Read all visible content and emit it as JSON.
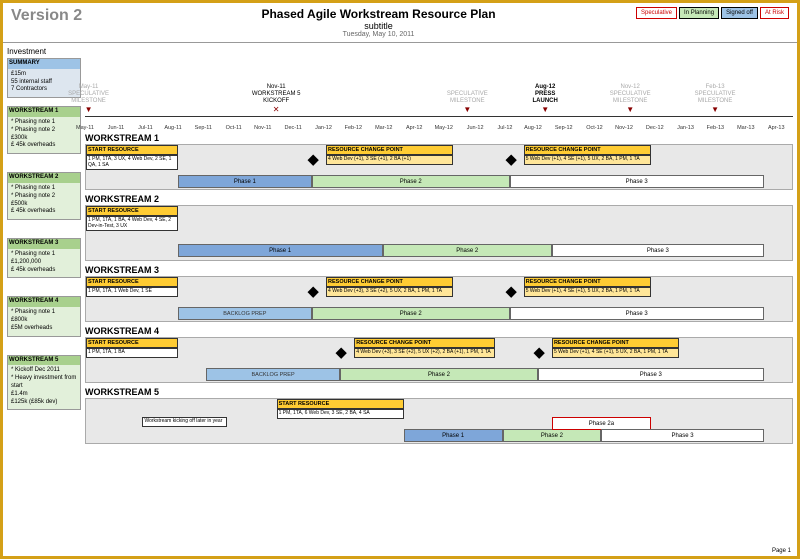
{
  "header": {
    "version": "Version 2",
    "title": "Phased Agile Workstream Resource Plan",
    "subtitle": "subtitle",
    "date": "Tuesday, May 10, 2011"
  },
  "legend": {
    "speculative": "Speculative",
    "planning": "In Planning",
    "signed": "Signed off",
    "risk": "At Risk"
  },
  "sidebar": {
    "investment": "Investment",
    "summary": {
      "title": "SUMMARY",
      "l1": "£15m",
      "l2": "55 internal staff",
      "l3": "7 Contractors"
    },
    "ws": [
      {
        "title": "WORKSTREAM 1",
        "l1": "* Phasing note 1",
        "l2": "* Phasing note 2",
        "l3": "£300k",
        "l4": "£ 45k overheads"
      },
      {
        "title": "WORKSTREAM 2",
        "l1": "* Phasing note 1",
        "l2": "* Phasing note 2",
        "l3": "£500k",
        "l4": "£ 45k overheads"
      },
      {
        "title": "WORKSTREAM 3",
        "l1": "* Phasing note 1",
        "l2": "",
        "l3": "£1,200,000",
        "l4": "£ 45k overheads"
      },
      {
        "title": "WORKSTREAM 4",
        "l1": "* Phasing note 1",
        "l2": "",
        "l3": "£800k",
        "l4": "£5M overheads"
      },
      {
        "title": "WORKSTREAM 5",
        "l1": "* Kickoff Dec 2011",
        "l2": "* Heavy investment from start",
        "l3": "£1.4m",
        "l4": "£125k (£85k dev)"
      }
    ]
  },
  "timeline": {
    "months": [
      "May-11",
      "Jun-11",
      "Jul-11",
      "Aug-11",
      "Sep-11",
      "Oct-11",
      "Nov-11",
      "Dec-11",
      "Jan-12",
      "Feb-12",
      "Mar-12",
      "Apr-12",
      "May-12",
      "Jun-12",
      "Jul-12",
      "Aug-12",
      "Sep-12",
      "Oct-12",
      "Nov-12",
      "Dec-12",
      "Jan-13",
      "Feb-13",
      "Mar-13",
      "Apr-13"
    ],
    "milestones": [
      {
        "pos": 0.5,
        "t1": "May-11",
        "t2": "SPECULATIVE",
        "t3": "MILESTONE",
        "gray": true,
        "mark": "▼"
      },
      {
        "pos": 27,
        "t1": "Nov-11",
        "t2": "WORKSTREAM 5",
        "t3": "KICKOFF",
        "gray": false,
        "mark": "✕"
      },
      {
        "pos": 54,
        "t1": "",
        "t2": "SPECULATIVE",
        "t3": "MILESTONE",
        "gray": true,
        "mark": "▼"
      },
      {
        "pos": 65,
        "t1": "Aug-12",
        "t2": "PRESS",
        "t3": "LAUNCH",
        "gray": false,
        "mark": "▼",
        "bold": true
      },
      {
        "pos": 77,
        "t1": "Nov-12",
        "t2": "SPECULATIVE",
        "t3": "MILESTONE",
        "gray": true,
        "mark": "▼"
      },
      {
        "pos": 89,
        "t1": "Feb-13",
        "t2": "SPECULATIVE",
        "t3": "MILESTONE",
        "gray": true,
        "mark": "▼"
      }
    ]
  },
  "workstreams": [
    {
      "title": "WORKSTREAM 1",
      "start": {
        "h": "START RESOURCE",
        "t": "1 PM, 1TA, 3 UX, 4 Web Dev, 2 SE, 1 QA, 1 SA"
      },
      "rc1": {
        "h": "RESOURCE CHANGE POINT",
        "t": "4 Web Dev (+1), 3 SE (+1), 2 BA (+1)"
      },
      "rc2": {
        "h": "RESOURCE CHANGE POINT",
        "t": "5 Web Dev (+1), 4 SE (+1), 5 UX, 2 BA, 1 PM, 1 TA"
      },
      "p1": "Phase 1",
      "p2": "Phase 2",
      "p3": "Phase 3"
    },
    {
      "title": "WORKSTREAM 2",
      "start": {
        "h": "START RESOURCE",
        "t": "1 PM, 1TA, 1 BA, 4 Web Dev, 4 SE, 2 Dev-in-Test, 3 UX"
      },
      "p1": "Phase 1",
      "p2": "Phase 2",
      "p3": "Phase 3"
    },
    {
      "title": "WORKSTREAM 3",
      "start": {
        "h": "START RESOURCE",
        "t": "1 PM, 1TA, 1 Web Dev, 1 SE"
      },
      "rc1": {
        "h": "RESOURCE CHANGE POINT",
        "t": "4 Web Dev (+3), 3 SE (+2), 5 UX, 2 BA, 1 PM, 1 TA"
      },
      "rc2": {
        "h": "RESOURCE CHANGE POINT",
        "t": "5 Web Dev (+1), 4 SE (+1), 5 UX, 2 BA, 1 PM, 1 TA"
      },
      "bl": "BACKLOG PREP",
      "p2": "Phase 2",
      "p3": "Phase 3"
    },
    {
      "title": "WORKSTREAM 4",
      "start": {
        "h": "START RESOURCE",
        "t": "1 PM, 1TA, 1 BA"
      },
      "rc1": {
        "h": "RESOURCE CHANGE POINT",
        "t": "4 Web Dev (+3), 3 SE (+2), 5 UX (+2), 2 BA (+1), 1 PM, 1 TA"
      },
      "rc2": {
        "h": "RESOURCE CHANGE POINT",
        "t": "5 Web Dev (+1), 4 SE (+1), 5 UX, 2 BA, 1 PM, 1 TA"
      },
      "bl": "BACKLOG PREP",
      "p2": "Phase 2",
      "p3": "Phase 3"
    },
    {
      "title": "WORKSTREAM 5",
      "start": {
        "h": "START RESOURCE",
        "t": "1 PM, 1TA, 6 Web Dev, 3 SE, 2 BA, 4 SA"
      },
      "note": "Workstream kicking off later in year",
      "p1": "Phase 1",
      "p2": "Phase 2",
      "p2a": "Phase 2a",
      "p3": "Phase 3"
    }
  ],
  "footer": {
    "page": "Page 1",
    "ts": ""
  }
}
